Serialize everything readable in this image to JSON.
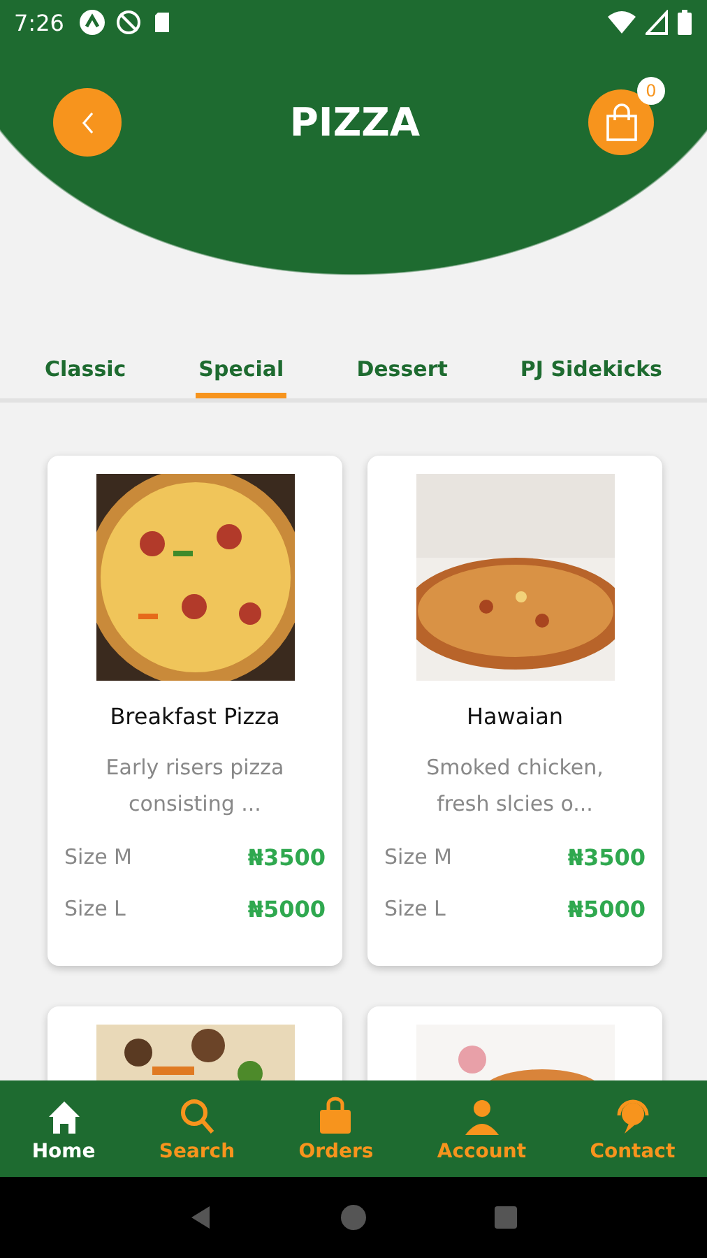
{
  "status_bar": {
    "time": "7:26"
  },
  "header": {
    "title": "PIZZA",
    "cart_count": "0"
  },
  "tabs": [
    {
      "label": "Classic",
      "selected": false
    },
    {
      "label": "Special",
      "selected": true
    },
    {
      "label": "Dessert",
      "selected": false
    },
    {
      "label": "PJ Sidekicks",
      "selected": false
    }
  ],
  "products": [
    {
      "kind": "full",
      "name": "Breakfast Pizza",
      "description": "Early risers pizza consisting ...",
      "prices": [
        {
          "size": "Size M",
          "price": "₦3500"
        },
        {
          "size": "Size L",
          "price": "₦5000"
        }
      ]
    },
    {
      "kind": "full",
      "name": "Hawaian",
      "description": "Smoked chicken, fresh slcies o...",
      "prices": [
        {
          "size": "Size M",
          "price": "₦3500"
        },
        {
          "size": "Size L",
          "price": "₦5000"
        }
      ]
    },
    {
      "kind": "picture"
    },
    {
      "kind": "picture"
    }
  ],
  "bottom_nav": [
    {
      "label": "Home",
      "selected": true
    },
    {
      "label": "Search",
      "selected": false
    },
    {
      "label": "Orders",
      "selected": false
    },
    {
      "label": "Account",
      "selected": false
    },
    {
      "label": "Contact",
      "selected": false
    }
  ]
}
